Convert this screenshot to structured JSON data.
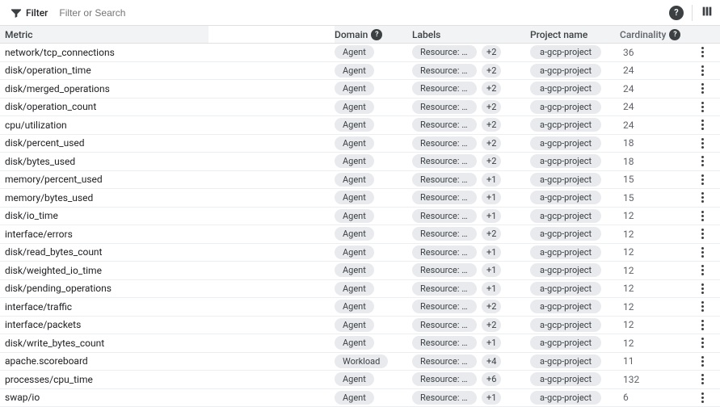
{
  "topbar": {
    "filter_label": "Filter",
    "filter_placeholder": "Filter or Search"
  },
  "columns": {
    "metric": "Metric",
    "domain": "Domain",
    "labels": "Labels",
    "project": "Project name",
    "cardinality": "Cardinality"
  },
  "rows": [
    {
      "metric": "network/tcp_connections",
      "domain": "Agent",
      "label": "Resource: gc…",
      "more": "+2",
      "project": "a-gcp-project",
      "card": "36"
    },
    {
      "metric": "disk/operation_time",
      "domain": "Agent",
      "label": "Resource: gc…",
      "more": "+2",
      "project": "a-gcp-project",
      "card": "24"
    },
    {
      "metric": "disk/merged_operations",
      "domain": "Agent",
      "label": "Resource: gc…",
      "more": "+2",
      "project": "a-gcp-project",
      "card": "24"
    },
    {
      "metric": "disk/operation_count",
      "domain": "Agent",
      "label": "Resource: gc…",
      "more": "+2",
      "project": "a-gcp-project",
      "card": "24"
    },
    {
      "metric": "cpu/utilization",
      "domain": "Agent",
      "label": "Resource: gc…",
      "more": "+2",
      "project": "a-gcp-project",
      "card": "24"
    },
    {
      "metric": "disk/percent_used",
      "domain": "Agent",
      "label": "Resource: gc…",
      "more": "+2",
      "project": "a-gcp-project",
      "card": "18"
    },
    {
      "metric": "disk/bytes_used",
      "domain": "Agent",
      "label": "Resource: gc…",
      "more": "+2",
      "project": "a-gcp-project",
      "card": "18"
    },
    {
      "metric": "memory/percent_used",
      "domain": "Agent",
      "label": "Resource: gc…",
      "more": "+1",
      "project": "a-gcp-project",
      "card": "15"
    },
    {
      "metric": "memory/bytes_used",
      "domain": "Agent",
      "label": "Resource: gc…",
      "more": "+1",
      "project": "a-gcp-project",
      "card": "15"
    },
    {
      "metric": "disk/io_time",
      "domain": "Agent",
      "label": "Resource: gc…",
      "more": "+1",
      "project": "a-gcp-project",
      "card": "12"
    },
    {
      "metric": "interface/errors",
      "domain": "Agent",
      "label": "Resource: gc…",
      "more": "+2",
      "project": "a-gcp-project",
      "card": "12"
    },
    {
      "metric": "disk/read_bytes_count",
      "domain": "Agent",
      "label": "Resource: gc…",
      "more": "+1",
      "project": "a-gcp-project",
      "card": "12"
    },
    {
      "metric": "disk/weighted_io_time",
      "domain": "Agent",
      "label": "Resource: gc…",
      "more": "+1",
      "project": "a-gcp-project",
      "card": "12"
    },
    {
      "metric": "disk/pending_operations",
      "domain": "Agent",
      "label": "Resource: gc…",
      "more": "+1",
      "project": "a-gcp-project",
      "card": "12"
    },
    {
      "metric": "interface/traffic",
      "domain": "Agent",
      "label": "Resource: gc…",
      "more": "+2",
      "project": "a-gcp-project",
      "card": "12"
    },
    {
      "metric": "interface/packets",
      "domain": "Agent",
      "label": "Resource: gc…",
      "more": "+2",
      "project": "a-gcp-project",
      "card": "12"
    },
    {
      "metric": "disk/write_bytes_count",
      "domain": "Agent",
      "label": "Resource: gc…",
      "more": "+1",
      "project": "a-gcp-project",
      "card": "12"
    },
    {
      "metric": "apache.scoreboard",
      "domain": "Workload",
      "label": "Resource: gc…",
      "more": "+4",
      "project": "a-gcp-project",
      "card": "11"
    },
    {
      "metric": "processes/cpu_time",
      "domain": "Agent",
      "label": "Resource: gc…",
      "more": "+6",
      "project": "a-gcp-project",
      "card": "132"
    },
    {
      "metric": "swap/io",
      "domain": "Agent",
      "label": "Resource: gc…",
      "more": "+1",
      "project": "a-gcp-project",
      "card": "6"
    }
  ]
}
